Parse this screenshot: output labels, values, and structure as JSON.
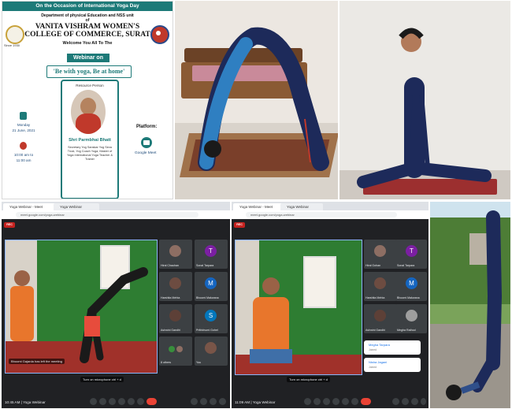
{
  "poster": {
    "occasion": "On the Occasion of International Yoga Day",
    "department": "Department of physical Education and NSS unit",
    "of": "of",
    "college": "VANITA VISHRAM WOMEN'S COLLEGE OF COMMERCE, SURAT",
    "welcome": "Welcome You All To The",
    "since": "Since 1930",
    "webinar_label": "Webinar on",
    "theme": "'Be with yoga, Be at home'",
    "resource_person_title": "Resource Person",
    "resource_person_name": "Shri Parmbhai Bhatt",
    "resource_person_info": "Secretary Yog Sanskar Yog Seva Trust, Yog Coach Yoga, Master of Yoga International Yoga Teacher & Trainer",
    "day": "Monday",
    "date": "21 June, 2021",
    "time_from": "10:00 am to",
    "time_to": "11:00 am",
    "platform_label": "Platform:",
    "platform": "Google Meet"
  },
  "meet_left": {
    "tab1": "Yoga Webinar - Meet",
    "tab2": "Yoga Webinar",
    "url": "meet.google.com/yoga-webinar",
    "rec": "REC",
    "participants": [
      {
        "initial": "",
        "name": "Hiral Chauhan"
      },
      {
        "initial": "T",
        "name": "Sonal Tarpara"
      },
      {
        "initial": "",
        "name": "Harshita Mehta"
      },
      {
        "initial": "M",
        "name": "Bhoomi Makwana"
      },
      {
        "initial": "",
        "name": "Ashwini Gandhi"
      },
      {
        "initial": "S",
        "name": "Prithbhumi Gohel"
      },
      {
        "initial": "",
        "name": "8 others"
      },
      {
        "initial": "",
        "name": "You"
      }
    ],
    "caption": "Bhoomi Gajarda has left the meeting",
    "mic_notice": "Turn on microphone  ctrl + d",
    "clock": "10:45 AM",
    "meeting_name": "Yoga Webinar"
  },
  "meet_right": {
    "tab1": "Yoga Webinar - Meet",
    "tab2": "Yoga Webinar",
    "url": "meet.google.com/yoga-webinar",
    "rec": "REC",
    "participants": [
      {
        "initial": "",
        "name": "Hiral Gohan"
      },
      {
        "initial": "T",
        "name": "Sonal Tarpara"
      },
      {
        "initial": "",
        "name": "Harshita Mehta"
      },
      {
        "initial": "M",
        "name": "Bhoomi Makwana"
      },
      {
        "initial": "",
        "name": "Ashwini Gandhi"
      },
      {
        "initial": "",
        "name": "Megha Rathod"
      }
    ],
    "toasts": [
      {
        "title": "Megha Tarpara",
        "sub": "Joined"
      },
      {
        "title": "Nisha Jagani",
        "sub": "Joined"
      }
    ],
    "mic_notice": "Turn on microphone  ctrl + d",
    "clock": "11:09 AM",
    "meeting_name": "Yoga Webinar"
  },
  "colors": {
    "poster_accent": "#1d7a78",
    "meet_bg": "#202124",
    "rec_red": "#c5221f",
    "end_call": "#ea4335",
    "link_blue": "#1a73e8"
  },
  "icons": [
    "calendar-icon",
    "clock-icon",
    "meet-logo-icon",
    "mic-icon",
    "camera-icon",
    "end-call-icon"
  ]
}
